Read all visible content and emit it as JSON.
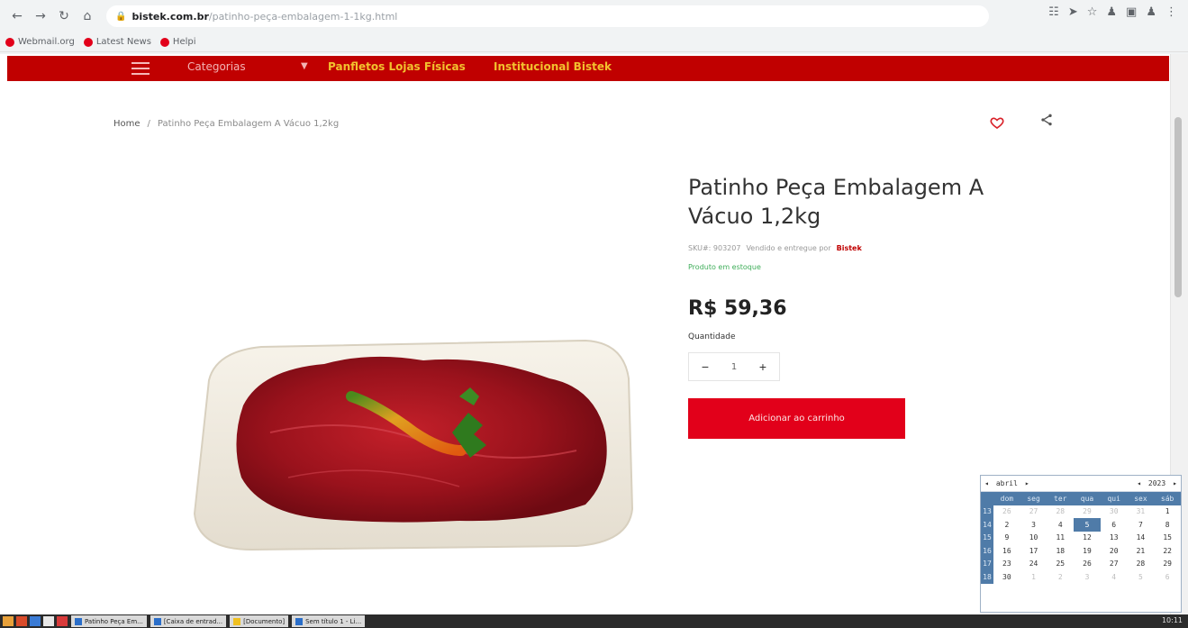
{
  "browser": {
    "url_host": "bistek.com.br",
    "url_path": "/patinho-peça-embalagem-1-1kg.html",
    "bookmarks": [
      "Webmail.org",
      "Latest News",
      "Helpi"
    ]
  },
  "nav": {
    "category_label": "Categorias",
    "link1": "Panfletos Lojas Físicas",
    "link2": "Institucional Bistek"
  },
  "breadcrumb": {
    "home": "Home",
    "separator": "/",
    "current": "Patinho Peça Embalagem A Vácuo 1,2kg"
  },
  "product": {
    "title": "Patinho Peça Embalagem A Vácuo 1,2kg",
    "sku_label": "SKU#: 903207",
    "sold_by_label": "Vendido e entregue por",
    "brand": "Bistek",
    "stock": "Produto em estoque",
    "price": "R$ 59,36",
    "quantity_label": "Quantidade",
    "quantity_value": "1",
    "add_to_cart": "Adicionar ao carrinho"
  },
  "calendar": {
    "month": "abril",
    "year": "2023",
    "weekdays": [
      "dom",
      "seg",
      "ter",
      "qua",
      "qui",
      "sex",
      "sáb"
    ],
    "weeks": [
      {
        "wk": "13",
        "days": [
          "26",
          "27",
          "28",
          "29",
          "30",
          "31",
          "1"
        ],
        "muted": [
          0,
          1,
          2,
          3,
          4,
          5
        ]
      },
      {
        "wk": "14",
        "days": [
          "2",
          "3",
          "4",
          "5",
          "6",
          "7",
          "8"
        ],
        "today": 3
      },
      {
        "wk": "15",
        "days": [
          "9",
          "10",
          "11",
          "12",
          "13",
          "14",
          "15"
        ]
      },
      {
        "wk": "16",
        "days": [
          "16",
          "17",
          "18",
          "19",
          "20",
          "21",
          "22"
        ]
      },
      {
        "wk": "17",
        "days": [
          "23",
          "24",
          "25",
          "26",
          "27",
          "28",
          "29"
        ]
      },
      {
        "wk": "18",
        "days": [
          "30",
          "1",
          "2",
          "3",
          "4",
          "5",
          "6"
        ],
        "muted": [
          1,
          2,
          3,
          4,
          5,
          6
        ]
      }
    ]
  },
  "taskbar": {
    "tasks": [
      "Patinho Peça Em...",
      "[Caixa de entrad...",
      "[Documento]",
      "Sem título 1 - Li..."
    ],
    "clock": "10:11"
  },
  "colors": {
    "brand_red": "#e2001a",
    "nav_red": "#c00000",
    "nav_link": "#f2c12e"
  }
}
